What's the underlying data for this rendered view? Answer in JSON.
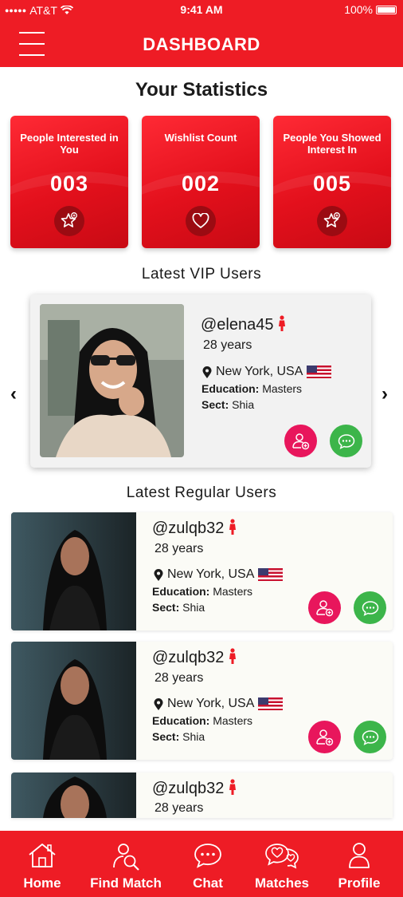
{
  "status_bar": {
    "carrier": "AT&T",
    "time": "9:41 AM",
    "battery": "100%"
  },
  "header": {
    "title": "DASHBOARD"
  },
  "statistics": {
    "title": "Your Statistics",
    "cards": [
      {
        "label": "People Interested in You",
        "value": "003",
        "icon": "star-badge-icon"
      },
      {
        "label": "Wishlist Count",
        "value": "002",
        "icon": "heart-icon"
      },
      {
        "label": "People You Showed Interest In",
        "value": "005",
        "icon": "star-badge-icon"
      }
    ]
  },
  "vip": {
    "title": "Latest VIP Users",
    "user": {
      "username": "@elena45",
      "age": "28 years",
      "location": "New York, USA",
      "education_label": "Education:",
      "education": "Masters",
      "sect_label": "Sect:",
      "sect": "Shia"
    }
  },
  "regular": {
    "title": "Latest Regular Users",
    "users": [
      {
        "username": "@zulqb32",
        "age": "28 years",
        "location": "New York, USA",
        "education_label": "Education:",
        "education": "Masters",
        "sect_label": "Sect:",
        "sect": "Shia"
      },
      {
        "username": "@zulqb32",
        "age": "28 years",
        "location": "New York, USA",
        "education_label": "Education:",
        "education": "Masters",
        "sect_label": "Sect:",
        "sect": "Shia"
      },
      {
        "username": "@zulqb32",
        "age": "28 years"
      }
    ]
  },
  "nav": {
    "items": [
      {
        "label": "Home",
        "icon": "home-icon"
      },
      {
        "label": "Find Match",
        "icon": "find-match-icon"
      },
      {
        "label": "Chat",
        "icon": "chat-icon"
      },
      {
        "label": "Matches",
        "icon": "matches-icon"
      },
      {
        "label": "Profile",
        "icon": "profile-icon"
      }
    ]
  },
  "colors": {
    "primary": "#ee1c25",
    "pink_button": "#e8165c",
    "green_button": "#3cb54a",
    "gender_icon": "#ee1c25"
  }
}
